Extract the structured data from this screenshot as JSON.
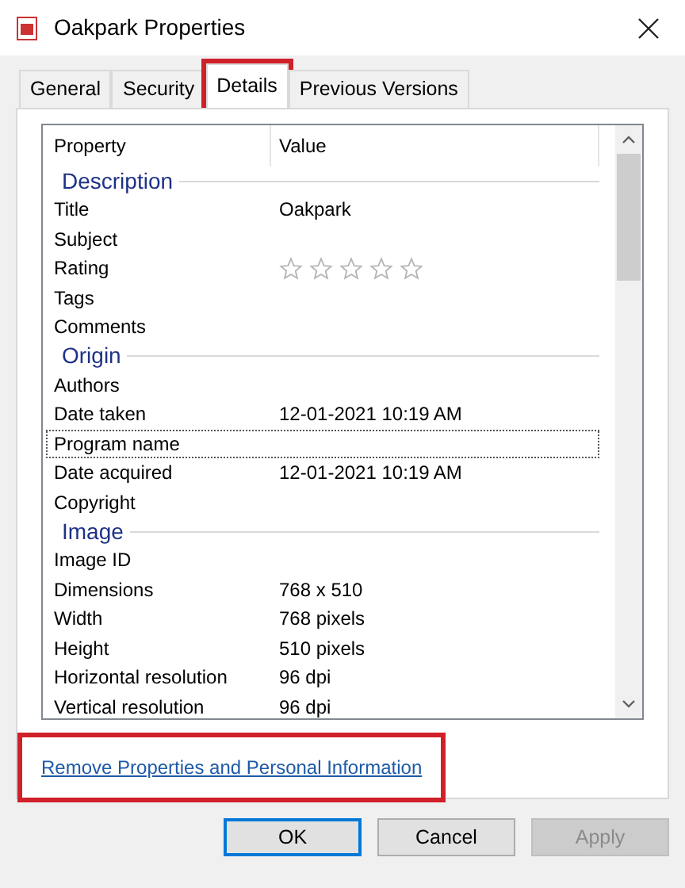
{
  "window": {
    "title": "Oakpark Properties"
  },
  "tabs": [
    {
      "label": "General",
      "selected": false,
      "highlighted": false
    },
    {
      "label": "Security",
      "selected": false,
      "highlighted": false
    },
    {
      "label": "Details",
      "selected": true,
      "highlighted": true
    },
    {
      "label": "Previous Versions",
      "selected": false,
      "highlighted": false
    }
  ],
  "table": {
    "columns": [
      "Property",
      "Value"
    ],
    "sections": [
      {
        "title": "Description",
        "rows": [
          {
            "kind": "text",
            "property": "Title",
            "value": "Oakpark",
            "focused": false
          },
          {
            "kind": "text",
            "property": "Subject",
            "focused": false
          },
          {
            "kind": "stars",
            "property": "Rating",
            "stars": 0,
            "focused": false
          },
          {
            "kind": "text",
            "property": "Tags",
            "focused": false
          },
          {
            "kind": "text",
            "property": "Comments",
            "focused": false
          }
        ]
      },
      {
        "title": "Origin",
        "rows": [
          {
            "kind": "text",
            "property": "Authors",
            "focused": false
          },
          {
            "kind": "text",
            "property": "Date taken",
            "value": "12-01-2021 10:19 AM",
            "focused": false
          },
          {
            "kind": "text",
            "property": "Program name",
            "focused": true
          },
          {
            "kind": "text",
            "property": "Date acquired",
            "value": "12-01-2021 10:19 AM",
            "focused": false
          },
          {
            "kind": "text",
            "property": "Copyright",
            "focused": false
          }
        ]
      },
      {
        "title": "Image",
        "rows": [
          {
            "kind": "text",
            "property": "Image ID",
            "focused": false
          },
          {
            "kind": "text",
            "property": "Dimensions",
            "value": "768 x 510",
            "focused": false
          },
          {
            "kind": "text",
            "property": "Width",
            "value": "768 pixels",
            "focused": false
          },
          {
            "kind": "text",
            "property": "Height",
            "value": "510 pixels",
            "focused": false
          },
          {
            "kind": "text",
            "property": "Horizontal resolution",
            "value": "96 dpi",
            "focused": false
          },
          {
            "kind": "text",
            "property": "Vertical resolution",
            "value": "96 dpi",
            "focused": false
          }
        ]
      }
    ]
  },
  "link": {
    "label": "Remove Properties and Personal Information",
    "highlighted": true
  },
  "buttons": [
    {
      "label": "OK",
      "kind": "default",
      "disabled": false
    },
    {
      "label": "Cancel",
      "kind": "normal",
      "disabled": false
    },
    {
      "label": "Apply",
      "kind": "normal",
      "disabled": true
    }
  ]
}
